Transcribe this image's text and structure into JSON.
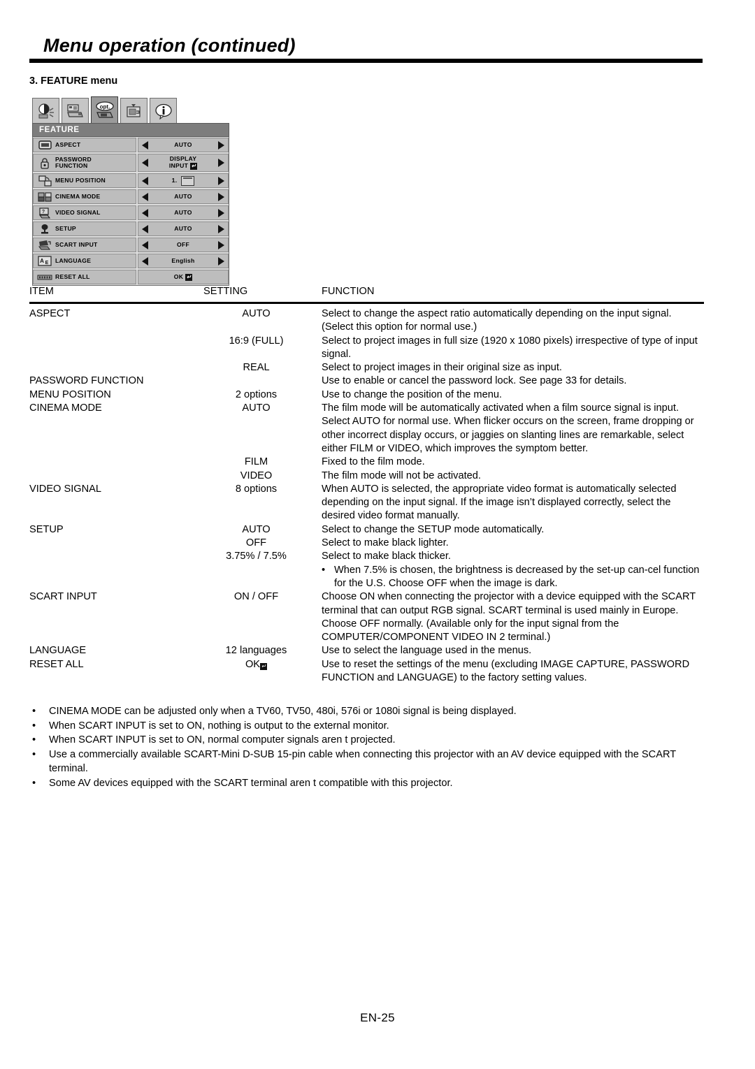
{
  "header": {
    "title": "Menu operation (continued)",
    "section": "3. FEATURE menu"
  },
  "osd": {
    "tabs": [
      {
        "name": "image-tab",
        "label": "image"
      },
      {
        "name": "installation-tab",
        "label": "installation"
      },
      {
        "name": "feature-tab",
        "label": "opt.",
        "selected": true
      },
      {
        "name": "signal-tab",
        "label": "signal"
      },
      {
        "name": "information-tab",
        "label": "i"
      }
    ],
    "menu_title": "FEATURE",
    "rows": [
      {
        "icon": "aspect-icon",
        "label": "ASPECT",
        "value": "AUTO",
        "arrows": true
      },
      {
        "icon": "password-icon",
        "label": "PASSWORD\nFUNCTION",
        "value": "DISPLAY\nINPUT",
        "value_enter": true,
        "arrows": true
      },
      {
        "icon": "menu-position-icon",
        "label": "MENU POSITION",
        "value": "1.",
        "value_screen": true,
        "arrows": true
      },
      {
        "icon": "cinema-mode-icon",
        "label": "CINEMA MODE",
        "value": "AUTO",
        "arrows": true
      },
      {
        "icon": "video-signal-icon",
        "label": "VIDEO SIGNAL",
        "value": "AUTO",
        "arrows": true
      },
      {
        "icon": "setup-icon",
        "label": "SETUP",
        "value": "AUTO",
        "arrows": true
      },
      {
        "icon": "scart-input-icon",
        "label": "SCART INPUT",
        "value": "OFF",
        "arrows": true
      },
      {
        "icon": "language-icon",
        "label": "LANGUAGE",
        "value": "English",
        "arrows": true
      },
      {
        "icon": "reset-all-icon",
        "label": "RESET ALL",
        "value": "OK",
        "value_enter": true,
        "arrows": false
      }
    ]
  },
  "table": {
    "headers": {
      "item": "ITEM",
      "setting": "SETTING",
      "function": "FUNCTION"
    },
    "rows": [
      {
        "item": "ASPECT",
        "setting": "AUTO",
        "function": "Select to change the aspect ratio automatically depending on the input signal. (Select this option for normal use.)"
      },
      {
        "item": "",
        "setting": "16:9 (FULL)",
        "function": "Select to project images in full size (1920 x 1080 pixels) irrespective of type of input signal."
      },
      {
        "item": "",
        "setting": "REAL",
        "function": "Select to project images in their original size as input."
      },
      {
        "item": "PASSWORD FUNCTION",
        "setting": "",
        "function": "Use to enable or cancel the password lock. See page 33 for details."
      },
      {
        "item": "MENU POSITION",
        "setting": "2 options",
        "function": "Use to change the position of the menu."
      },
      {
        "item": "CINEMA MODE",
        "setting": "AUTO",
        "function": "The film mode will be automatically activated when a film source signal is input.\nSelect AUTO for normal use.\nWhen flicker occurs on the screen, frame dropping or other incorrect display occurs, or jaggies on slanting lines are remarkable, select either FILM or VIDEO, which improves the symptom better."
      },
      {
        "item": "",
        "setting": "FILM",
        "function": "Fixed to the film mode."
      },
      {
        "item": "",
        "setting": "VIDEO",
        "function": "The film mode will not be activated."
      },
      {
        "item": "VIDEO SIGNAL",
        "setting": "8 options",
        "function": "When AUTO is selected, the appropriate video format is automatically selected depending on the input signal. If the image isn’t displayed correctly, select the desired video format manually."
      },
      {
        "item": "SETUP",
        "setting": "AUTO",
        "function": "Select to change the SETUP mode automatically."
      },
      {
        "item": "",
        "setting": "OFF",
        "function": "Select to make black lighter."
      },
      {
        "item": "",
        "setting": "3.75% / 7.5%",
        "function": "Select to make black thicker.",
        "sub_bullet": "When 7.5% is chosen, the brightness is decreased by the set-up can-cel function for the U.S. Choose OFF when the image is dark."
      },
      {
        "item": "SCART INPUT",
        "setting": "ON / OFF",
        "function": "Choose ON when connecting the projector with a device equipped with the SCART terminal that can output RGB signal. SCART terminal is used mainly in Europe. Choose OFF normally. (Available only for the input signal from the COMPUTER/COMPONENT VIDEO IN 2 terminal.)"
      },
      {
        "item": "LANGUAGE",
        "setting": "12 languages",
        "function": "Use to select the language used in the menus."
      },
      {
        "item": "RESET ALL",
        "setting": "OK",
        "setting_enter": true,
        "function": "Use to reset the settings of the menu (excluding IMAGE CAPTURE, PASSWORD FUNCTION and LANGUAGE) to the factory setting values."
      }
    ]
  },
  "notes": {
    "bullet": "•",
    "items": [
      "CINEMA MODE can be adjusted only when a TV60, TV50, 480i, 576i or 1080i signal is being displayed.",
      "When SCART INPUT is set to ON, nothing is output to the external monitor.",
      "When SCART INPUT is set to ON, normal computer signals aren t projected.",
      "Use a commercially available SCART-Mini D-SUB 15-pin cable when connecting this projector with an AV device equipped with the SCART terminal.",
      "Some AV devices equipped with the SCART terminal aren t compatible with this projector."
    ]
  },
  "footer": {
    "page_number": "EN-25"
  },
  "colors": {
    "osd_header_bg": "#7d7d7d",
    "osd_row_bg": "#bdbdbd",
    "osd_tab_selected_bg": "#9a9a9a",
    "rule": "#000000"
  }
}
